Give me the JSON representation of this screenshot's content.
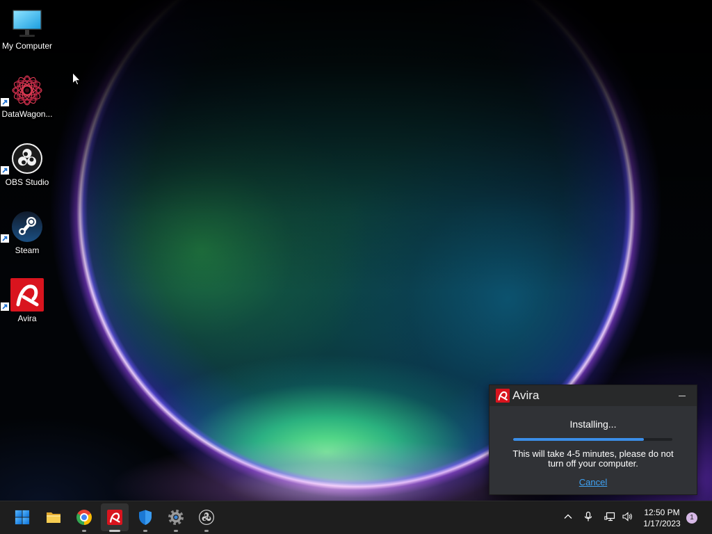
{
  "theme": {
    "taskbar_bg": "#1e1e1e",
    "accent": "#3b8ee8",
    "link": "#3fa3f5",
    "avira_red": "#d9141e"
  },
  "desktop": {
    "icons": [
      {
        "label": "My Computer",
        "icon": "my-computer-icon",
        "shortcut": false
      },
      {
        "label": "DataWagon...",
        "icon": "datawagon-icon",
        "shortcut": true
      },
      {
        "label": "OBS Studio",
        "icon": "obs-studio-icon",
        "shortcut": true
      },
      {
        "label": "Steam",
        "icon": "steam-icon",
        "shortcut": true
      },
      {
        "label": "Avira",
        "icon": "avira-icon",
        "shortcut": true
      }
    ],
    "cursor": "mouse-pointer-icon"
  },
  "installer": {
    "title": "Avira",
    "logo_icon": "avira-logo-icon",
    "minimize_icon": "minimize-icon",
    "status": "Installing...",
    "progress": 0.82,
    "message": "This will take 4-5 minutes, please do not turn off your computer.",
    "cancel_label": "Cancel"
  },
  "taskbar": {
    "pinned": [
      {
        "icon": "windows-start-icon",
        "running": false,
        "active": false
      },
      {
        "icon": "file-explorer-icon",
        "running": false,
        "active": false
      },
      {
        "icon": "chrome-icon",
        "running": true,
        "active": false
      },
      {
        "icon": "avira-icon",
        "running": true,
        "active": true
      },
      {
        "icon": "windows-security-icon",
        "running": true,
        "active": false
      },
      {
        "icon": "settings-icon",
        "running": true,
        "active": false
      },
      {
        "icon": "obs-studio-icon",
        "running": true,
        "active": false
      }
    ],
    "tray": {
      "icons": [
        "chevron-up-icon",
        "microphone-icon",
        "network-icon",
        "volume-icon"
      ],
      "time": "12:50 PM",
      "date": "1/17/2023",
      "notification_count": "1"
    }
  }
}
